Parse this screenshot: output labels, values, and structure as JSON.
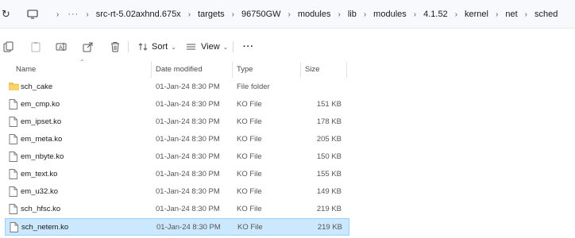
{
  "address_bar": {
    "refresh_icon": "refresh-icon",
    "pc_icon": "monitor-icon",
    "ellipsis": "···",
    "breadcrumbs": [
      "src-rt-5.02axhnd.675x",
      "targets",
      "96750GW",
      "modules",
      "lib",
      "modules",
      "4.1.52",
      "kernel",
      "net",
      "sched"
    ]
  },
  "toolbar": {
    "sort_label": "Sort",
    "view_label": "View",
    "more_label": "···"
  },
  "columns": {
    "name": "Name",
    "date": "Date modified",
    "type": "Type",
    "size": "Size"
  },
  "files": [
    {
      "name": "sch_cake",
      "date": "01-Jan-24 8:30 PM",
      "type": "File folder",
      "size": "",
      "icon": "folder-icon"
    },
    {
      "name": "em_cmp.ko",
      "date": "01-Jan-24 8:30 PM",
      "type": "KO File",
      "size": "151 KB",
      "icon": "file-icon"
    },
    {
      "name": "em_ipset.ko",
      "date": "01-Jan-24 8:30 PM",
      "type": "KO File",
      "size": "178 KB",
      "icon": "file-icon"
    },
    {
      "name": "em_meta.ko",
      "date": "01-Jan-24 8:30 PM",
      "type": "KO File",
      "size": "205 KB",
      "icon": "file-icon"
    },
    {
      "name": "em_nbyte.ko",
      "date": "01-Jan-24 8:30 PM",
      "type": "KO File",
      "size": "150 KB",
      "icon": "file-icon"
    },
    {
      "name": "em_text.ko",
      "date": "01-Jan-24 8:30 PM",
      "type": "KO File",
      "size": "155 KB",
      "icon": "file-icon"
    },
    {
      "name": "em_u32.ko",
      "date": "01-Jan-24 8:30 PM",
      "type": "KO File",
      "size": "149 KB",
      "icon": "file-icon"
    },
    {
      "name": "sch_hfsc.ko",
      "date": "01-Jan-24 8:30 PM",
      "type": "KO File",
      "size": "219 KB",
      "icon": "file-icon"
    },
    {
      "name": "sch_netem.ko",
      "date": "01-Jan-24 8:30 PM",
      "type": "KO File",
      "size": "219 KB",
      "icon": "file-icon",
      "selected": true
    }
  ],
  "colors": {
    "selection_bg": "#cce8ff",
    "selection_border": "#99d1ff",
    "folder": "#f3c24a"
  }
}
